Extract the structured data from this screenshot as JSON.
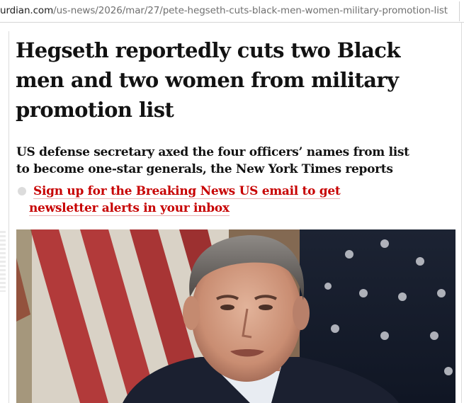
{
  "browser": {
    "url_host": "urdian.com",
    "url_path": "/us-news/2026/mar/27/pete-hegseth-cuts-black-men-women-military-promotion-list"
  },
  "article": {
    "headline": "Hegseth reportedly cuts two Black men and two women from military promotion list",
    "standfirst": "US defense secretary axed the four officers’ names from list to become one-star generals, the New York Times reports",
    "newsletter_link": "Sign up for the Breaking News US email to get newsletter alerts in your inbox"
  },
  "colors": {
    "headline": "#121212",
    "link": "#c70000",
    "rule": "#dcdcdc"
  }
}
